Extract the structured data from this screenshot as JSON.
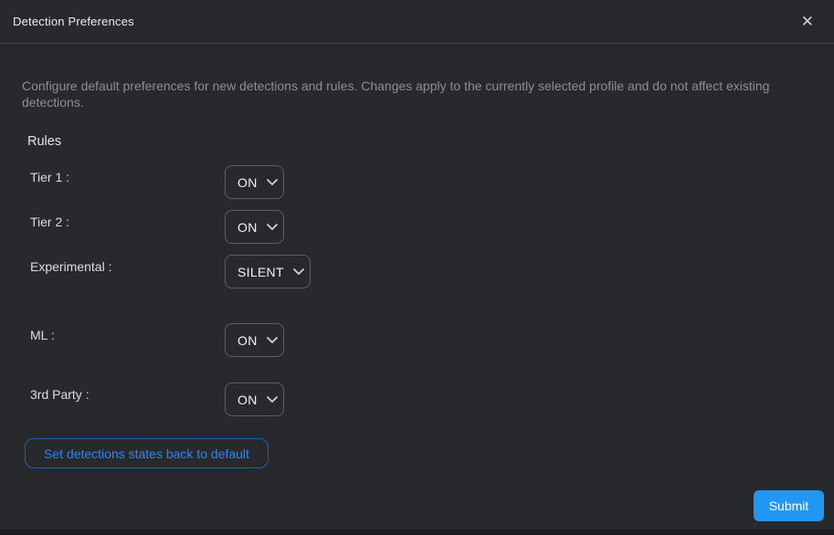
{
  "dialog": {
    "title": "Detection Preferences",
    "close_icon": "✕",
    "description": "Configure default preferences for new detections and rules. Changes apply to the currently selected profile and do not affect existing detections.",
    "section_title": "Rules"
  },
  "rules": [
    {
      "label": "Tier 1 :",
      "value": "ON"
    },
    {
      "label": "Tier 2 :",
      "value": "ON"
    },
    {
      "label": "Experimental :",
      "value": "SILENT"
    },
    {
      "label": "ML :",
      "value": "ON"
    },
    {
      "label": "3rd Party :",
      "value": "ON"
    }
  ],
  "buttons": {
    "reset": "Set detections states back to default",
    "submit": "Submit"
  },
  "colors": {
    "accent_blue": "#2196f3",
    "link_blue": "#2e86f0",
    "dialog_background": "#27292d",
    "border_gray": "#5c5f63"
  }
}
